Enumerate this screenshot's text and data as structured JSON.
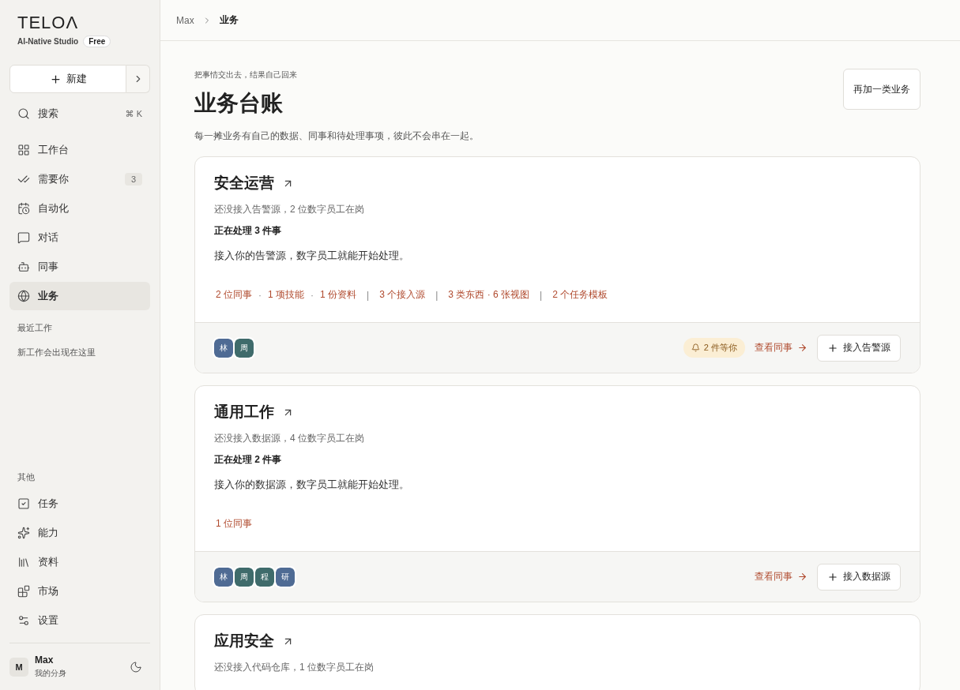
{
  "sidebar": {
    "logo": "TELOΛ",
    "subtitle": "AI-Native Studio",
    "plan_badge": "Free",
    "new_button": "新建",
    "search": {
      "label": "搜索",
      "shortcut": "⌘ K"
    },
    "nav": [
      {
        "label": "工作台",
        "selected": false
      },
      {
        "label": "需要你",
        "selected": false,
        "count": "3"
      },
      {
        "label": "自动化",
        "selected": false
      },
      {
        "label": "对话",
        "selected": false
      },
      {
        "label": "同事",
        "selected": false
      },
      {
        "label": "业务",
        "selected": true
      }
    ],
    "recent_heading": "最近工作",
    "recent_empty": "新工作会出现在这里",
    "other_heading": "其他",
    "other": [
      {
        "label": "任务",
        "selected": false
      },
      {
        "label": "能力",
        "selected": false
      },
      {
        "label": "资料",
        "selected": false
      },
      {
        "label": "市场",
        "selected": false
      },
      {
        "label": "设置",
        "selected": false
      }
    ],
    "user": {
      "initial": "M",
      "name": "Max",
      "subtitle": "我的分身"
    }
  },
  "breadcrumb": [
    "Max",
    "业务"
  ],
  "header": {
    "eyebrow": "把事情交出去，结果自己回来",
    "title": "业务台账",
    "description": "每一摊业务有自己的数据、同事和待处理事项，彼此不会串在一起。",
    "button": "再加一类业务"
  },
  "cards": [
    {
      "title": "安全运营",
      "status": "还没接入告警源，2 位数字员工在岗",
      "processing": "正在处理 3 件事",
      "hint": "接入你的告警源，数字员工就能开始处理。",
      "links": [
        {
          "text": "2 位同事"
        },
        {
          "sep": "·",
          "text": "1 项技能"
        },
        {
          "sep": "·",
          "text": "1 份资料"
        },
        {
          "sep": "|",
          "text": "3 个接入源"
        },
        {
          "sep": "|",
          "text": "3 类东西 · 6 张视图"
        },
        {
          "sep": "|",
          "text": "2 个任务模板"
        }
      ],
      "avatars": [
        {
          "initial": "林",
          "color": "#4f6b94"
        },
        {
          "initial": "周",
          "color": "#3f6b6b"
        }
      ],
      "waiting": "2 件等你",
      "view_link": "查看同事",
      "action": "接入告警源"
    },
    {
      "title": "通用工作",
      "status": "还没接入数据源，4 位数字员工在岗",
      "processing": "正在处理 2 件事",
      "hint": "接入你的数据源，数字员工就能开始处理。",
      "links": [
        {
          "text": "1 位同事"
        }
      ],
      "avatars": [
        {
          "initial": "林",
          "color": "#4f6b94"
        },
        {
          "initial": "周",
          "color": "#3f6b6b"
        },
        {
          "initial": "程",
          "color": "#3f6b6b"
        },
        {
          "initial": "研",
          "color": "#4f6b94"
        }
      ],
      "view_link": "查看同事",
      "action": "接入数据源"
    },
    {
      "title": "应用安全",
      "status": "还没接入代码仓库，1 位数字员工在岗"
    }
  ]
}
